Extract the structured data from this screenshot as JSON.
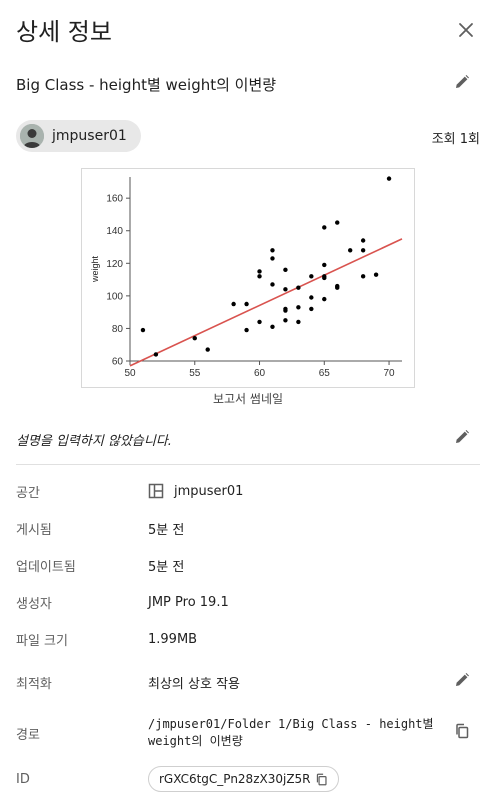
{
  "panel": {
    "title": "상세 정보"
  },
  "report": {
    "title": "Big Class - height별 weight의 이변량",
    "owner": "jmpuser01",
    "views": "조회 1회",
    "thumbnail_caption": "보고서 썸네일",
    "description": "설명을 입력하지 않았습니다."
  },
  "details": {
    "space": {
      "label": "공간",
      "value": "jmpuser01"
    },
    "published": {
      "label": "게시됨",
      "value": "5분 전"
    },
    "updated": {
      "label": "업데이트됨",
      "value": "5분 전"
    },
    "creator": {
      "label": "생성자",
      "value": "JMP Pro 19.1"
    },
    "file_size": {
      "label": "파일 크기",
      "value": "1.99MB"
    },
    "optimization": {
      "label": "최적화",
      "value": "최상의 상호 작용"
    },
    "path": {
      "label": "경로",
      "value": "/jmpuser01/Folder 1/Big Class - height별 weight의 이변량"
    },
    "id": {
      "label": "ID",
      "value": "rGXC6tgC_Pn28zX30jZ5R"
    }
  },
  "colors": {
    "accent_line": "#d9534f",
    "text": "#212121",
    "muted": "#5f5f5f"
  },
  "icons": [
    "close-icon",
    "pencil-icon",
    "avatar-icon",
    "space-layout-icon",
    "copy-icon"
  ],
  "chart_data": {
    "type": "scatter",
    "ylabel": "weight",
    "xlim": [
      50,
      71
    ],
    "ylim": [
      60,
      173
    ],
    "x_ticks": [
      50,
      55,
      60,
      65,
      70
    ],
    "y_ticks": [
      60,
      80,
      100,
      120,
      140,
      160
    ],
    "fit_line": {
      "x": [
        50,
        71
      ],
      "y": [
        57,
        135
      ]
    },
    "points": [
      [
        51,
        79
      ],
      [
        52,
        64
      ],
      [
        55,
        74
      ],
      [
        56,
        67
      ],
      [
        58,
        95
      ],
      [
        59,
        95
      ],
      [
        59,
        79
      ],
      [
        60,
        115
      ],
      [
        60,
        112
      ],
      [
        60,
        84
      ],
      [
        61,
        128
      ],
      [
        61,
        123
      ],
      [
        61,
        107
      ],
      [
        61,
        81
      ],
      [
        62,
        116
      ],
      [
        62,
        104
      ],
      [
        62,
        92
      ],
      [
        62,
        91
      ],
      [
        62,
        85
      ],
      [
        63,
        105
      ],
      [
        63,
        93
      ],
      [
        63,
        84
      ],
      [
        64,
        112
      ],
      [
        64,
        99
      ],
      [
        64,
        92
      ],
      [
        65,
        142
      ],
      [
        65,
        119
      ],
      [
        65,
        112
      ],
      [
        65,
        111
      ],
      [
        65,
        98
      ],
      [
        66,
        145
      ],
      [
        66,
        106
      ],
      [
        66,
        105
      ],
      [
        67,
        128
      ],
      [
        68,
        134
      ],
      [
        68,
        128
      ],
      [
        68,
        112
      ],
      [
        69,
        113
      ],
      [
        70,
        172
      ]
    ]
  }
}
